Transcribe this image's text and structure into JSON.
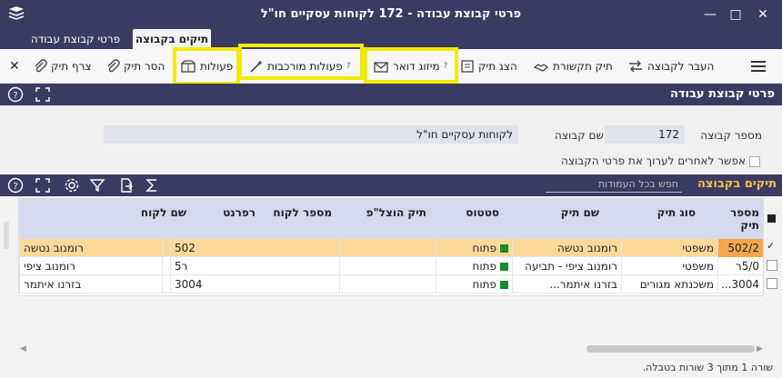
{
  "window": {
    "title": "פרטי קבוצת עבודה - 172 לקוחות עסקיים חו\"ל",
    "controls": {
      "minimize": "—",
      "maximize": "□",
      "close": "✕"
    }
  },
  "tabs": [
    {
      "label": "תיקים בקבוצה",
      "active": true
    },
    {
      "label": "פרטי קבוצת עבודה",
      "active": false
    }
  ],
  "toolbar": {
    "transfer": "העבר לקבוצה",
    "comm_file": "תיק תקשורת",
    "show_file": "הצג תיק",
    "mail_merge": "מיזוג דואר",
    "complex_actions": "פעולות מורכבות",
    "actions": "פעולות",
    "remove_file": "הסר תיק",
    "attach_file": "צרף תיק",
    "help_mark": "?"
  },
  "section": {
    "title": "פרטי קבוצת עבודה"
  },
  "form": {
    "group_number_label": "מספר קבוצה",
    "group_number_value": "172",
    "group_name_label": "שם קבוצה",
    "group_name_value": "לקוחות עסקיים חו\"ל",
    "allow_edit_label": "אפשר לאחרים לערוך את פרטי הקבוצה"
  },
  "subgrid": {
    "title": "תיקים בקבוצה",
    "search_placeholder": "חפש בכל העמודות",
    "columns": {
      "file_num": "מספר תיק",
      "file_type": "סוג תיק",
      "file_name": "שם תיק",
      "status": "סטטוס",
      "exec_file": "תיק הוצל\"פ",
      "client_num": "מספר לקוח",
      "reference": "רפרנט",
      "client_name": "שם לקוח"
    },
    "rows": [
      {
        "file_num": "502/2",
        "file_type": "משפטי",
        "file_name": "רומנוב נטשה",
        "status": "פתוח",
        "exec_file": "",
        "client_num": "502",
        "reference": "",
        "client_name": "רומנוב נטשה",
        "selected": true
      },
      {
        "file_num": "5/0ר",
        "file_type": "משפטי",
        "file_name": "רומנוב ציפי - תביעה",
        "status": "פתוח",
        "exec_file": "",
        "client_num": "ר5",
        "reference": "",
        "client_name": "רומנוב ציפי",
        "selected": false
      },
      {
        "file_num": "3004...",
        "file_type": "משכנתא מגורים",
        "file_name": "בזרנו איתמר...",
        "status": "פתוח",
        "exec_file": "",
        "client_num": "3004",
        "reference": "",
        "client_name": "בזרנו איתמר",
        "selected": false
      }
    ],
    "footer": "שורה 1 מתוך 3 שורות בטבלה."
  },
  "colors": {
    "header_bg": "#3b3a63",
    "accent": "#f5c542",
    "highlight": "#f2ea00",
    "selected_row": "#fbd999",
    "status_open": "#1b8a2b"
  }
}
